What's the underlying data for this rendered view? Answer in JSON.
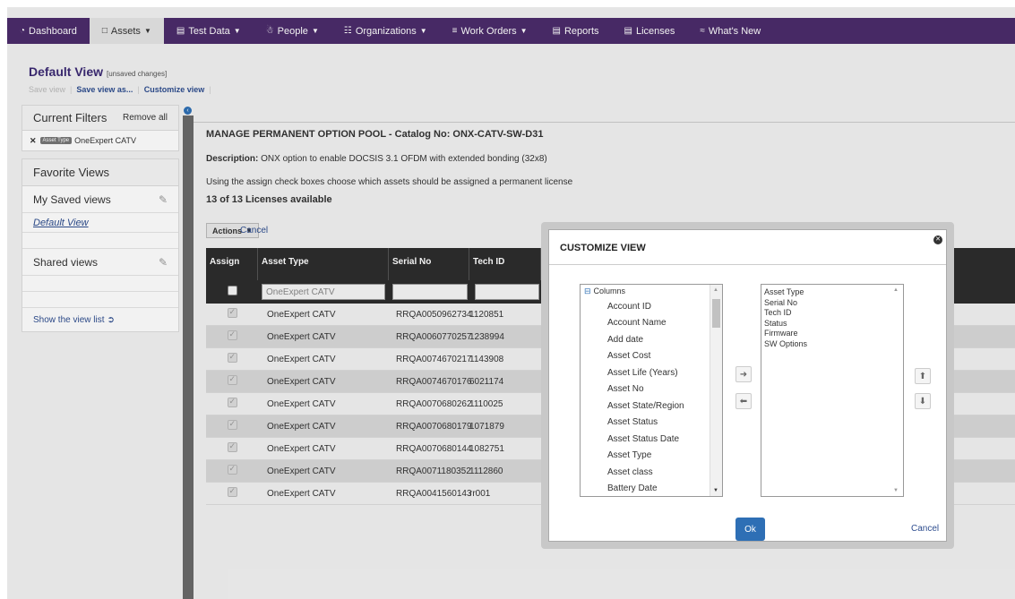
{
  "nav": [
    {
      "icon": "dashboard-icon",
      "glyph": "◔",
      "label": "Dashboard",
      "caret": false,
      "active": false
    },
    {
      "icon": "assets-icon",
      "glyph": "□",
      "label": "Assets",
      "caret": true,
      "active": true
    },
    {
      "icon": "test-data-icon",
      "glyph": "▤",
      "label": "Test Data",
      "caret": true,
      "active": false
    },
    {
      "icon": "people-icon",
      "glyph": "☃",
      "label": "People",
      "caret": true,
      "active": false
    },
    {
      "icon": "organizations-icon",
      "glyph": "☷",
      "label": "Organizations",
      "caret": true,
      "active": false
    },
    {
      "icon": "work-orders-icon",
      "glyph": "≡",
      "label": "Work Orders",
      "caret": true,
      "active": false
    },
    {
      "icon": "reports-icon",
      "glyph": "▤",
      "label": "Reports",
      "caret": false,
      "active": false
    },
    {
      "icon": "licenses-icon",
      "glyph": "▤",
      "label": "Licenses",
      "caret": false,
      "active": false
    },
    {
      "icon": "rss-icon",
      "glyph": "≈",
      "label": "What's New",
      "caret": false,
      "active": false
    }
  ],
  "view": {
    "title": "Default View",
    "unsaved": "[unsaved changes]",
    "save_view": "Save view",
    "save_view_as": "Save view as...",
    "customize_view": "Customize view"
  },
  "filters": {
    "heading": "Current Filters",
    "remove_all": "Remove all",
    "tag": "Asset Type",
    "value": "OneExpert CATV"
  },
  "favorites": {
    "heading": "Favorite Views",
    "my_saved": "My Saved views",
    "default_view": "Default View",
    "shared": "Shared views",
    "show_list": "Show the view list"
  },
  "main": {
    "title": "MANAGE PERMANENT OPTION POOL - Catalog No: ONX-CATV-SW-D31",
    "desc_label": "Description:",
    "desc_text": "ONX option to enable DOCSIS 3.1 OFDM with extended bonding (32x8)",
    "instructions": "Using the assign check boxes choose which assets should be assigned a permanent license",
    "count": "13 of 13 Licenses available",
    "actions_label": "Actions",
    "cancel_label": "Cancel"
  },
  "grid": {
    "columns": [
      "Assign",
      "Asset Type",
      "Serial No",
      "Tech ID"
    ],
    "filter_asset_type": "OneExpert CATV",
    "rows": [
      {
        "type": "OneExpert CATV",
        "serial": "RRQA0050962734",
        "tech": "1120851"
      },
      {
        "type": "OneExpert CATV",
        "serial": "RRQA0060770257",
        "tech": "1238994"
      },
      {
        "type": "OneExpert CATV",
        "serial": "RRQA0074670217",
        "tech": "1143908"
      },
      {
        "type": "OneExpert CATV",
        "serial": "RRQA0074670176",
        "tech": "6021174"
      },
      {
        "type": "OneExpert CATV",
        "serial": "RRQA0070680262",
        "tech": "1110025"
      },
      {
        "type": "OneExpert CATV",
        "serial": "RRQA0070680179",
        "tech": "1071879"
      },
      {
        "type": "OneExpert CATV",
        "serial": "RRQA0070680144",
        "tech": "1082751"
      },
      {
        "type": "OneExpert CATV",
        "serial": "RRQA0071180352",
        "tech": "1112860"
      },
      {
        "type": "OneExpert CATV",
        "serial": "RRQA0041560143",
        "tech": "rr001"
      }
    ]
  },
  "modal": {
    "title": "CUSTOMIZE VIEW",
    "tree_root": "Columns",
    "available": [
      "Account ID",
      "Account Name",
      "Add date",
      "Asset Cost",
      "Asset Life (Years)",
      "Asset No",
      "Asset State/Region",
      "Asset Status",
      "Asset Status Date",
      "Asset Type",
      "Asset class",
      "Battery Date"
    ],
    "selected": [
      "Asset Type",
      "Serial No",
      "Tech ID",
      "Status",
      "Firmware",
      "SW Options"
    ],
    "ok": "Ok",
    "cancel": "Cancel"
  },
  "colors": {
    "navbar": "#4b2c6b",
    "link": "#2e4d8f",
    "primary_button": "#2e6fb5",
    "grid_header": "#2d2d2d"
  }
}
